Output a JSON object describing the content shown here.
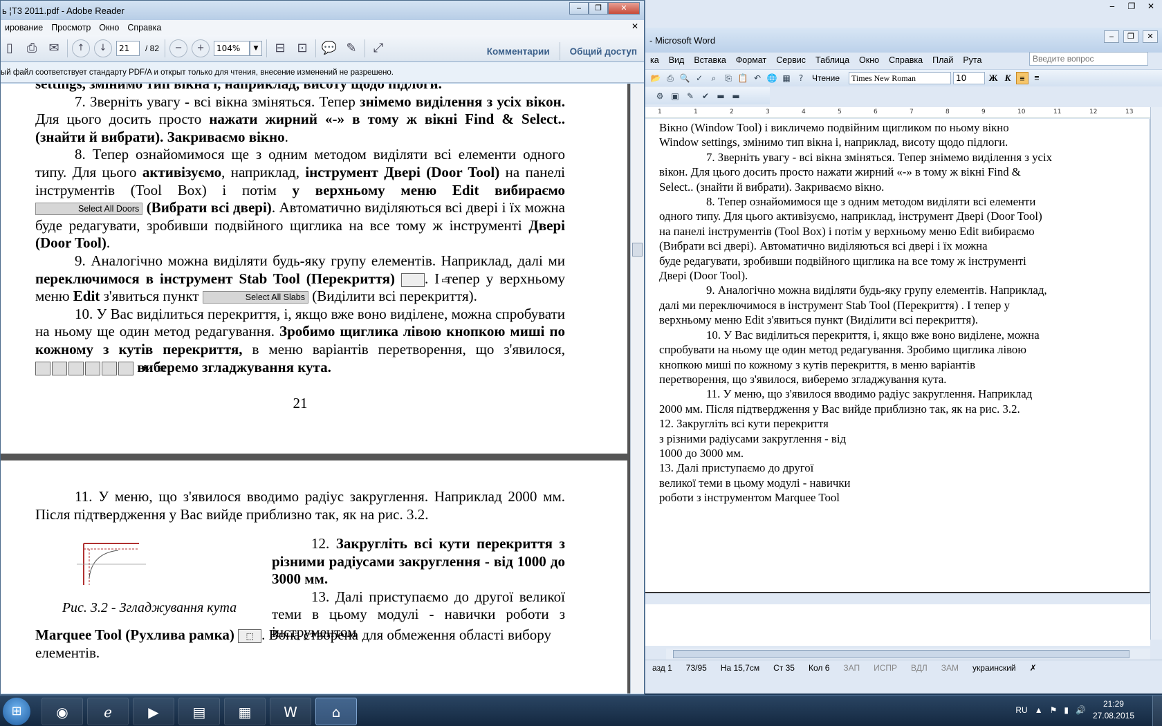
{
  "word": {
    "title": "- Microsoft Word",
    "menu": [
      "ка",
      "Вид",
      "Вставка",
      "Формат",
      "Сервис",
      "Таблица",
      "Окно",
      "Справка",
      "Плай",
      "Рута"
    ],
    "ask_placeholder": "Введите вопрос",
    "read_label": "Чтение",
    "font": "Times New Roman",
    "font_size": "10",
    "ruler_marks": [
      "1",
      "1",
      "2",
      "3",
      "4",
      "5",
      "6",
      "7",
      "8",
      "9",
      "10",
      "11",
      "12",
      "13"
    ],
    "doc_lines": [
      {
        "t": "Вікно (Window Tool) і викличемо подвійним щигликом по ньому вікно",
        "i": false
      },
      {
        "t": "Window settings, змінимо тип вікна і, наприклад, висоту щодо підлоги.",
        "i": false
      },
      {
        "t": "7. Зверніть увагу - всі вікна зміняться. Тепер знімемо виділення з усіх",
        "i": true
      },
      {
        "t": "вікон. Для цього досить просто нажати жирний «-» в тому ж вікні Find &",
        "i": false
      },
      {
        "t": "Select.. (знайти й вибрати). Закриваємо вікно.",
        "i": false
      },
      {
        "t": "8. Тепер ознайомимося ще з одним методом виділяти всі елементи",
        "i": true
      },
      {
        "t": "одного типу. Для цього активізуємо, наприклад, інструмент Двері (Door Tool)",
        "i": false
      },
      {
        "t": "на панелі інструментів (Tool Box) і потім у верхньому меню Edit вибираємо",
        "i": false
      },
      {
        "t": "(Вибрати всі двері). Автоматично виділяються всі двері і їх можна",
        "i": false
      },
      {
        "t": "буде редагувати, зробивши подвійного щиглика на все тому ж інструменті",
        "i": false
      },
      {
        "t": "Двері (Door Tool).",
        "i": false
      },
      {
        "t": "9. Аналогічно можна виділяти будь-яку групу елементів. Наприклад,",
        "i": true
      },
      {
        "t": "далі ми переключимося в інструмент Stab Tool (Перекриття) . І тепер у",
        "i": false
      },
      {
        "t": "верхньому меню Edit з'явиться пункт (Виділити всі перекриття).",
        "i": false
      },
      {
        "t": "10. У Вас виділиться перекриття, і, якщо вже воно виділене, можна",
        "i": true
      },
      {
        "t": "спробувати на ньому ще один метод редагування. Зробимо щиглика лівою",
        "i": false
      },
      {
        "t": "кнопкою миші по кожному з кутів перекриття, в меню варіантів",
        "i": false
      },
      {
        "t": "перетворення, що з'явилося, виберемо згладжування кута.",
        "i": false
      },
      {
        "t": "11. У меню, що з'явилося вводимо радіус закруглення. Наприклад",
        "i": true
      },
      {
        "t": "2000 мм. Після підтвердження у Вас вийде приблизно так, як на рис. 3.2.",
        "i": false
      },
      {
        "t": "12. Закругліть всі кути перекриття",
        "i": false
      },
      {
        "t": "з різними радіусами закруглення - від",
        "i": false
      },
      {
        "t": "1000 до 3000 мм.",
        "i": false
      },
      {
        "t": "13. Далі приступаємо до другої",
        "i": false
      },
      {
        "t": "великої теми в цьому модулі - навички",
        "i": false
      },
      {
        "t": "роботи з інструментом Marquee Tool",
        "i": false
      }
    ],
    "status": {
      "section": "азд 1",
      "pages": "73/95",
      "at": "На 15,7см",
      "line": "Ст 35",
      "col": "Кол 6",
      "rec": "ЗАП",
      "trk": "ИСПР",
      "ext": "ВДЛ",
      "ovr": "ЗАМ",
      "lang": "украинский"
    }
  },
  "reader": {
    "title": "ь ¦Т3 2011.pdf - Adobe Reader",
    "menu": [
      "ирование",
      "Просмотр",
      "Окно",
      "Справка"
    ],
    "page_current": "21",
    "page_total": "/ 82",
    "zoom": "104%",
    "comments_label": "Комментарии",
    "share_label": "Общий доступ",
    "info": "ый файл соответствует стандарту PDF/A и открыт только для чтения, внесение изменений не разрешено.",
    "page1": {
      "top_fragment": "settings, змінимо тип вікна і, наприклад, висоту щодо підлоги.",
      "p7a": "7. Зверніть увагу - всі вікна зміняться. Тепер ",
      "p7b": "знімемо виділення з усіх вікон.",
      "p7c": " Для цього досить просто ",
      "p7d": "нажати жирний «-» в тому ж вікні Find & Select.. (знайти й вибрати). Закриваємо вікно",
      "p7e": ".",
      "p8a": "8. Тепер ознайомимося ще з одним методом виділяти всі елементи одного типу. Для цього ",
      "p8b": "активізуємо",
      "p8c": ", наприклад, ",
      "p8d": "інструмент Двері (Door Tool)",
      "p8e": " на панелі інструментів (Tool Box) і потім ",
      "p8f": "у верхньому меню Edit вибираємо",
      "chip_doors": "Select All Doors",
      "p8g": " (Вибрати всі двері)",
      "p8h": ". Автоматично виділяються всі двері і їх можна буде редагувати, зробивши подвійного щиглика на все тому ж інструменті ",
      "p8i": "Двері (Door Tool)",
      "p8j": ".",
      "p9a": "9. Аналогічно можна виділяти будь-яку групу елементів. Наприклад, далі ми ",
      "p9b": "переключимося в інструмент Stab Tool (Перекриття)",
      "p9c": ". І тепер у верхньому меню ",
      "p9d": "Edit",
      "p9e": " з'явиться пункт ",
      "chip_slabs": "Select All Slabs",
      "p9f": " (Виділити всі перекриття).",
      "p10a": "10. У Вас виділиться перекриття, і, якщо вже воно виділене, можна спробувати на ньому ще один метод редагування. ",
      "p10b": "Зробимо щиглика лівою кнопкою миші по кожному з кутів перекриття,",
      "p10c": " в меню варіантів перетворення, що з'явилося, ",
      "p10d": " виберемо згладжування кута.",
      "page_number": "21"
    },
    "page2": {
      "p11": "11. У меню, що з'явилося вводимо радіус закруглення. Наприклад 2000 мм. Після підтвердження у Вас вийде приблизно так, як на рис. 3.2.",
      "p12a": "12. ",
      "p12b": "Закругліть всі кути перекриття з різними радіусами закруглення - від 1000 до 3000 мм.",
      "p13a": "13. Далі приступаємо до другої великої теми в цьому модулі - навички роботи з інструментом ",
      "p13b": "Marquee Tool",
      "p13c": "(Рухлива рамка)",
      "p13d": ". Вона створена для обмеження області вибору елементів.",
      "fig_caption": "Рис. 3.2 - Згладжування кута"
    }
  },
  "taskbar": {
    "lang": "RU",
    "time": "21:29",
    "date": "27.08.2015"
  }
}
